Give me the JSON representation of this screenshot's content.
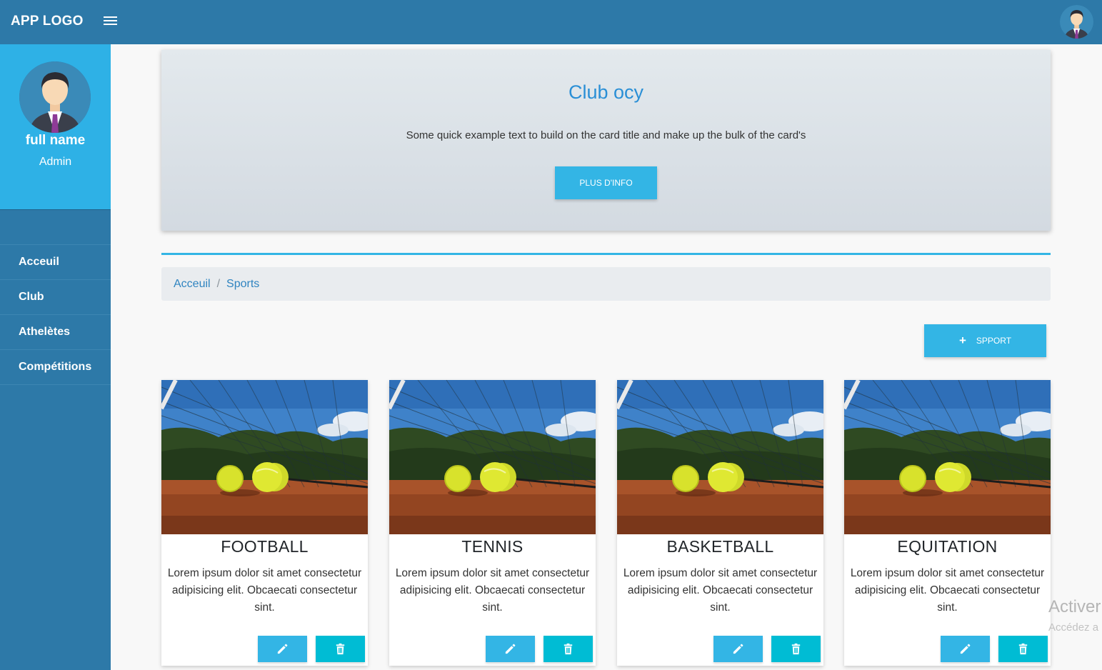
{
  "header": {
    "logo": "APP LOGO"
  },
  "profile": {
    "name": "full name",
    "role": "Admin"
  },
  "sidebar": {
    "items": [
      {
        "label": "Acceuil"
      },
      {
        "label": "Club"
      },
      {
        "label": "Athelètes"
      },
      {
        "label": "Compétitions"
      }
    ]
  },
  "hero": {
    "title": "Club ocy",
    "text": "Some quick example text to build on the card title and make up the bulk of the card's",
    "button": "PLUS D'INFO"
  },
  "breadcrumb": {
    "items": [
      "Acceuil",
      "Sports"
    ],
    "separator": "/"
  },
  "add_button": {
    "label": "SPPORT",
    "icon": "plus-icon"
  },
  "cards": [
    {
      "title": "FOOTBALL",
      "text": "Lorem ipsum dolor sit amet consectetur adipisicing elit. Obcaecati consectetur sint."
    },
    {
      "title": "TENNIS",
      "text": "Lorem ipsum dolor sit amet consectetur adipisicing elit. Obcaecati consectetur sint."
    },
    {
      "title": "BASKETBALL",
      "text": "Lorem ipsum dolor sit amet consectetur adipisicing elit. Obcaecati consectetur sint."
    },
    {
      "title": "EQUITATION",
      "text": "Lorem ipsum dolor sit amet consectetur adipisicing elit. Obcaecati consectetur sint."
    }
  ],
  "card_icons": {
    "edit": "pencil-icon",
    "delete": "trash-icon"
  },
  "watermark": {
    "title": "Activer",
    "subtitle": "Accédez a"
  },
  "colors": {
    "topbar": "#2d79a8",
    "sidebar_profile": "#2eb1e6",
    "accent": "#33b5e5",
    "delete": "#00bcd4",
    "hero_title": "#2a8fd6"
  }
}
